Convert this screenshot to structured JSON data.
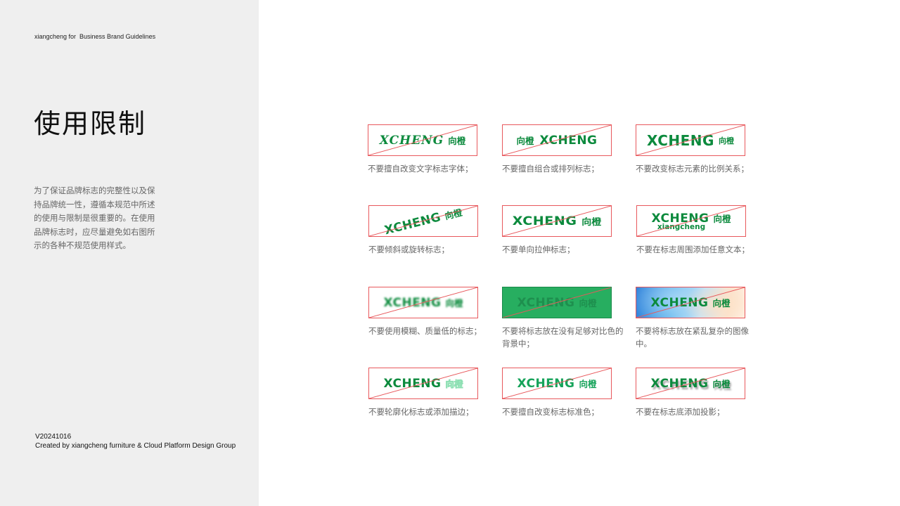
{
  "sidebar": {
    "brand_line": "xiangcheng for  Business Brand Guidelines",
    "title": "使用限制",
    "intro_lines": [
      "为了保证品牌标志的完整性以及保",
      "持品牌统一性，遵循本规范中所述",
      "的使用与限制是很重要的。在使用",
      "品牌标志时，应尽量避免如右图所",
      "示的各种不规范使用样式。"
    ],
    "version": "V20241016",
    "credit": "Created by xiangcheng furniture & Cloud Platform Design Group"
  },
  "logo": {
    "wordmark": "XCHENG",
    "chinese": "向橙",
    "subtext": "xiangcheng"
  },
  "colors": {
    "brand_green": "#0c8a3d",
    "prohibit_red": "#e8585c",
    "low_contrast_bg": "#27ae60"
  },
  "examples": [
    {
      "caption": "不要擅自改变文字标志字体；"
    },
    {
      "caption": "不要擅自组合或排列标志；"
    },
    {
      "caption": "不要改变标志元素的比例关系；"
    },
    {
      "caption": "不要倾斜或旋转标志；"
    },
    {
      "caption": "不要单向拉伸标志；"
    },
    {
      "caption": "不要在标志周围添加任意文本；"
    },
    {
      "caption": "不要使用模糊、质量低的标志；"
    },
    {
      "caption": "不要将标志放在没有足够对比色的背景中；"
    },
    {
      "caption": "不要将标志放在紧乱复杂的图像中。"
    },
    {
      "caption": "不要轮廓化标志或添加描边；"
    },
    {
      "caption": "不要擅自改变标志标准色；"
    },
    {
      "caption": "不要在标志底添加投影；"
    }
  ]
}
